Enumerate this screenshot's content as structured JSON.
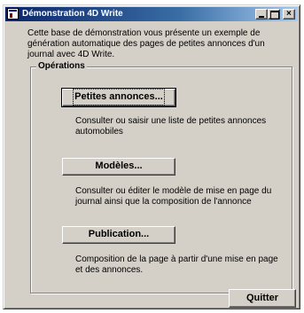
{
  "window": {
    "title": "Démonstration 4D Write",
    "controls": {
      "minimize": "_",
      "maximize": "□",
      "close": "×"
    }
  },
  "intro": {
    "text": "Cette base de démonstration vous présente un exemple de génération automatique des pages de petites annonces d'un journal avec 4D Write."
  },
  "operations": {
    "label": "Opérations",
    "items": [
      {
        "button_label": "Petites annonces...",
        "description": "Consulter ou saisir une liste de petites annonces automobiles"
      },
      {
        "button_label": "Modèles...",
        "description": "Consulter ou éditer le modèle de mise en page du journal ainsi que la composition de l'annonce"
      },
      {
        "button_label": "Publication...",
        "description": "Composition de la page à partir d'une mise en page et des annonces."
      }
    ]
  },
  "footer": {
    "quit_label": "Quitter"
  }
}
